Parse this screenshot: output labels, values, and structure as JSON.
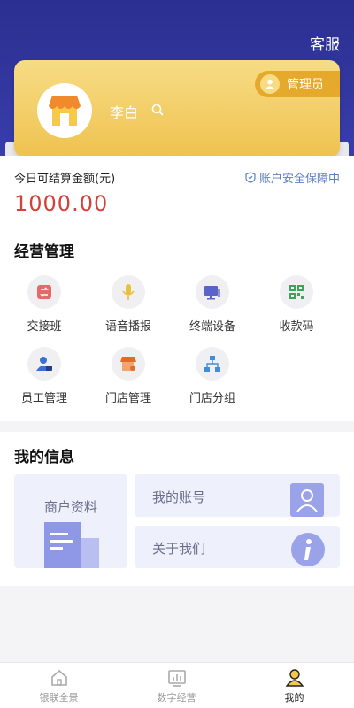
{
  "header": {
    "service_label": "客服"
  },
  "profile": {
    "name": "李白",
    "role": "管理员"
  },
  "settlement": {
    "label": "今日可结算金额(元)",
    "security_label": "账户安全保障中",
    "amount": "1000.00"
  },
  "business": {
    "title": "经营管理",
    "items": [
      {
        "label": "交接班",
        "icon": "shift-handover-icon"
      },
      {
        "label": "语音播报",
        "icon": "microphone-icon"
      },
      {
        "label": "终端设备",
        "icon": "terminal-device-icon"
      },
      {
        "label": "收款码",
        "icon": "qr-code-icon"
      },
      {
        "label": "员工管理",
        "icon": "staff-icon"
      },
      {
        "label": "门店管理",
        "icon": "store-icon"
      },
      {
        "label": "门店分组",
        "icon": "store-group-icon"
      }
    ]
  },
  "info": {
    "title": "我的信息",
    "merchant_label": "商户资料",
    "account_label": "我的账号",
    "about_label": "关于我们"
  },
  "tabs": [
    {
      "label": "银联全景",
      "icon": "home-icon",
      "active": false
    },
    {
      "label": "数字经营",
      "icon": "chart-icon",
      "active": false
    },
    {
      "label": "我的",
      "icon": "user-icon",
      "active": true
    }
  ],
  "colors": {
    "header": "#2b2f8f",
    "card": "#efc24f",
    "amount": "#d2413a",
    "security": "#5b7fc4"
  }
}
